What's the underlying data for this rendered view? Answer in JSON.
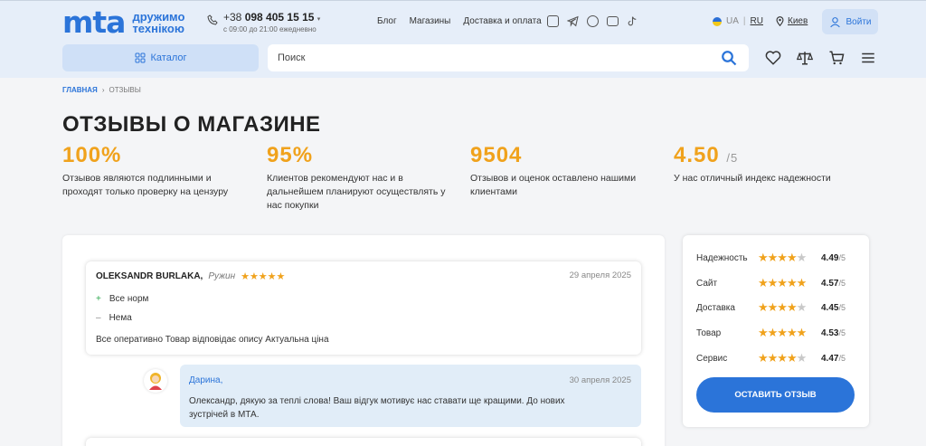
{
  "header": {
    "logo": "mta",
    "logo_tagline_1": "дружимо",
    "logo_tagline_2": "технікою",
    "phone_prefix": "+38",
    "phone_number": "098 405 15 15",
    "phone_hours": "с 09:00 до 21:00 ежедневно",
    "nav": [
      "Блог",
      "Магазины",
      "Доставка и оплата"
    ],
    "socials": [
      "instagram-icon",
      "telegram-icon",
      "viber-icon",
      "youtube-icon",
      "tiktok-icon"
    ],
    "lang_ua": "UA",
    "lang_sep": "|",
    "lang_ru": "RU",
    "city": "Киев",
    "login": "Войти",
    "catalog": "Каталог",
    "search_placeholder": "Поиск"
  },
  "breadcrumb": {
    "home": "Главная",
    "sep": "›",
    "current": "Отзывы"
  },
  "page_title": "ОТЗЫВЫ О МАГАЗИНЕ",
  "stats": [
    {
      "value": "100%",
      "suffix": "",
      "desc": "Отзывов являются подлинными и проходят только проверку на цензуру"
    },
    {
      "value": "95%",
      "suffix": "",
      "desc": "Клиентов рекомендуют нас и в дальнейшем планируют осуществлять у нас покупки"
    },
    {
      "value": "9504",
      "suffix": "",
      "desc": "Отзывов и оценок оставлено нашими клиентами"
    },
    {
      "value": "4.50",
      "suffix": "/5",
      "desc": "У нас отличный индекс надежности"
    }
  ],
  "review": {
    "author": "OLEKSANDR BURLAKA,",
    "city": "Ружин",
    "stars": "★★★★★",
    "rating": 5,
    "date": "29 апреля 2025",
    "plus_sign": "+",
    "pros": "Все норм",
    "minus_sign": "–",
    "cons": "Нема",
    "text": "Все оперативно Товар відповідає опису Актуальна ціна"
  },
  "reply": {
    "author": "Дарина,",
    "date": "30 апреля 2025",
    "text": "Олександр, дякую за теплі слова! Ваш відгук мотивує нас ставати ще кращими. До нових зустрічей в МТА."
  },
  "ratings": [
    {
      "label": "Надежность",
      "value": "4.49",
      "scale": "/5",
      "stars_on": "★★★★",
      "stars_off": "★"
    },
    {
      "label": "Сайт",
      "value": "4.57",
      "scale": "/5",
      "stars_on": "★★★★★",
      "stars_off": ""
    },
    {
      "label": "Доставка",
      "value": "4.45",
      "scale": "/5",
      "stars_on": "★★★★",
      "stars_off": "★"
    },
    {
      "label": "Товар",
      "value": "4.53",
      "scale": "/5",
      "stars_on": "★★★★★",
      "stars_off": ""
    },
    {
      "label": "Сервис",
      "value": "4.47",
      "scale": "/5",
      "stars_on": "★★★★",
      "stars_off": "★"
    }
  ],
  "cta": "Оставить отзыв",
  "colors": {
    "accent": "#2b74d9",
    "star": "#f0a21c",
    "header_bg": "#e6eef9"
  }
}
